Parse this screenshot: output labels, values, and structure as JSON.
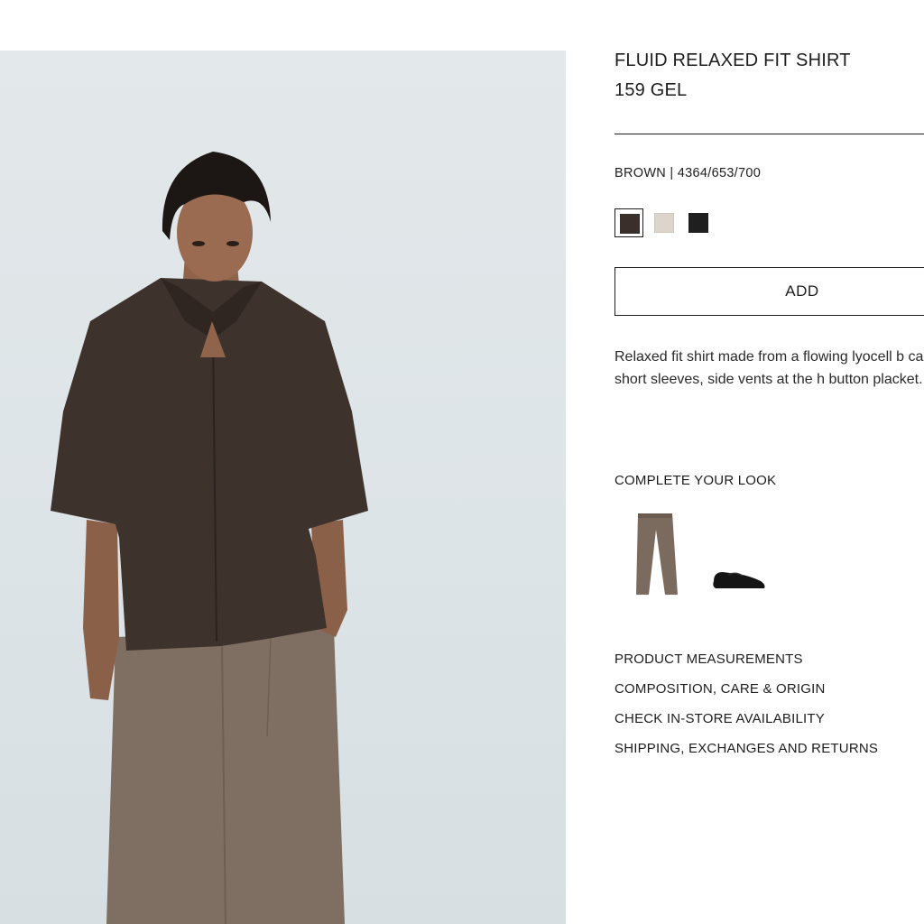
{
  "product": {
    "name": "FLUID RELAXED FIT SHIRT",
    "price": "159 GEL",
    "color_line": "BROWN | 4364/653/700",
    "colors": [
      {
        "name": "brown",
        "hex": "#3b2f2b",
        "selected": true
      },
      {
        "name": "ecru",
        "hex": "#dcd5cc",
        "selected": false
      },
      {
        "name": "black",
        "hex": "#1f1f1f",
        "selected": false
      }
    ],
    "add_label": "ADD",
    "description": "Relaxed fit shirt made from a flowing lyocell b camp collar, short sleeves, side vents at the h button placket."
  },
  "look": {
    "title": "COMPLETE YOUR LOOK",
    "items": [
      {
        "name": "trousers",
        "icon": "trousers-icon",
        "color": "#7b6a5e"
      },
      {
        "name": "loafers",
        "icon": "loafer-icon",
        "color": "#141414"
      }
    ]
  },
  "info_links": [
    "PRODUCT MEASUREMENTS",
    "COMPOSITION, CARE & ORIGIN",
    "CHECK IN-STORE AVAILABILITY",
    "SHIPPING, EXCHANGES AND RETURNS"
  ],
  "colors": {
    "text": "#1d1d1d",
    "photo_background": "#e1e7e9",
    "shirt": "#3d322c",
    "trousers": "#7f6e62"
  }
}
